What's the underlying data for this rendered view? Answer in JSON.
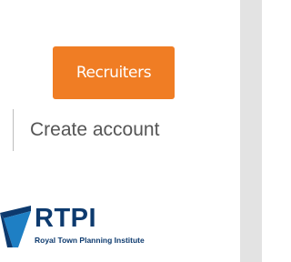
{
  "header": {
    "recruiters_label": "Recruiters",
    "create_account_label": "Create account"
  },
  "logo": {
    "title": "RTPI",
    "subtitle": "Royal Town Planning Institute"
  },
  "colors": {
    "accent": "#f07d24",
    "brand_navy": "#0d3a6e",
    "brand_blue": "#1e7fc4",
    "link_text": "#555555",
    "side_panel": "#e3e3e3"
  }
}
